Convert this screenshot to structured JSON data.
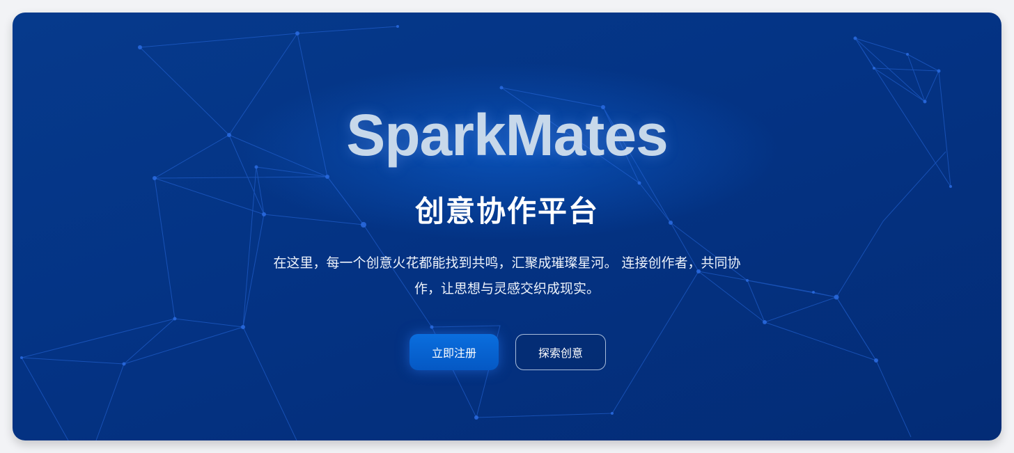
{
  "hero": {
    "brand": "SparkMates",
    "subtitle": "创意协作平台",
    "description_line1": "在这里，每一个创意火花都能找到共鸣，汇聚成璀璨星河。 连接创作者，共同协",
    "description_line2": "作，让思想与灵感交织成现实。",
    "primary_button": "立即注册",
    "secondary_button": "探索创意"
  },
  "colors": {
    "background": "#043384",
    "accent": "#0a6ede",
    "brand_text": "#c7d8ea",
    "network_lines": "#2a6be0"
  }
}
